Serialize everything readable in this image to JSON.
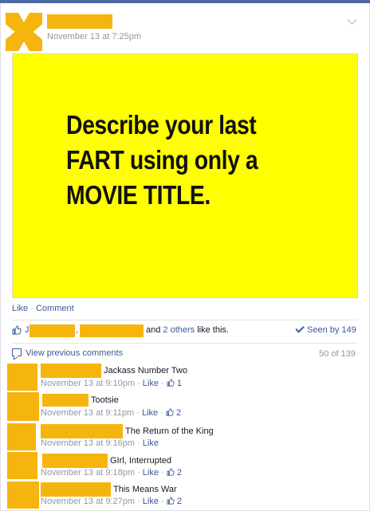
{
  "post": {
    "timestamp": "November 13 at 7:25pm",
    "image_text": [
      "Describe your last",
      "FART using only a",
      "MOVIE TITLE."
    ],
    "actions": {
      "like": "Like",
      "dot": " · ",
      "comment": "Comment"
    }
  },
  "likes": {
    "and_text": "and",
    "others_link": "2 others",
    "suffix": "like this.",
    "seen_by": "Seen by 149"
  },
  "comments_header": {
    "view_previous": "View previous comments",
    "count": "50 of 139"
  },
  "comments": [
    {
      "text": "Jackass Number Two",
      "time": "November 13 at 9:10pm",
      "like": "Like",
      "likes": "1"
    },
    {
      "text": "Tootsie",
      "time": "November 13 at 9:11pm",
      "like": "Like",
      "likes": "2"
    },
    {
      "text": "The Return of the King",
      "time": "November 13 at 9:16pm",
      "like": "Like",
      "likes": ""
    },
    {
      "text": "GIrl, Interrupted",
      "time": "November 13 at 9:18pm",
      "like": "Like",
      "likes": "2"
    },
    {
      "text": "This Means War",
      "time": "November 13 at 9:27pm",
      "like": "Like",
      "likes": "2"
    }
  ],
  "colors": {
    "link": "#3b5998",
    "redaction": "#f6b40e",
    "image_bg": "#ffff00"
  }
}
